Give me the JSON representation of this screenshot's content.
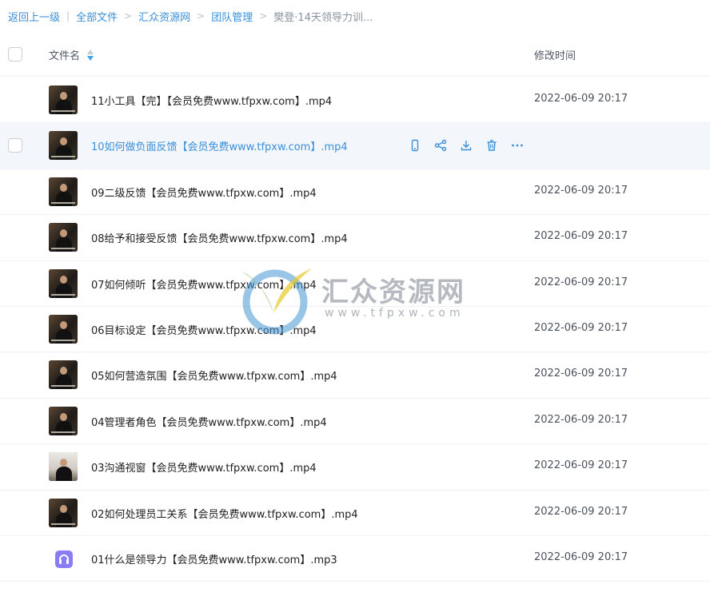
{
  "breadcrumb": {
    "back": "返回上一级",
    "all_files": "全部文件",
    "level1": "汇众资源网",
    "level2": "团队管理",
    "current": "樊登·14天领导力训..."
  },
  "header": {
    "name_col": "文件名",
    "time_col": "修改时间"
  },
  "rows": [
    {
      "name": "11小工具【完】【会员免费www.tfpxw.com】.mp4",
      "time": "2022-06-09 20:17"
    },
    {
      "name": "10如何做负面反馈【会员免费www.tfpxw.com】.mp4",
      "time": ""
    },
    {
      "name": "09二级反馈【会员免费www.tfpxw.com】.mp4",
      "time": "2022-06-09 20:17"
    },
    {
      "name": "08给予和接受反馈【会员免费www.tfpxw.com】.mp4",
      "time": "2022-06-09 20:17"
    },
    {
      "name": "07如何倾听【会员免费www.tfpxw.com】.mp4",
      "time": "2022-06-09 20:17"
    },
    {
      "name": "06目标设定【会员免费www.tfpxw.com】.mp4",
      "time": "2022-06-09 20:17"
    },
    {
      "name": "05如何营造氛围【会员免费www.tfpxw.com】.mp4",
      "time": "2022-06-09 20:17"
    },
    {
      "name": "04管理者角色【会员免费www.tfpxw.com】.mp4",
      "time": "2022-06-09 20:17"
    },
    {
      "name": "03沟通视窗【会员免费www.tfpxw.com】.mp4",
      "time": "2022-06-09 20:17"
    },
    {
      "name": "02如何处理员工关系【会员免费www.tfpxw.com】.mp4",
      "time": "2022-06-09 20:17"
    },
    {
      "name": "01什么是领导力【会员免费www.tfpxw.com】.mp3",
      "time": "2022-06-09 20:17"
    }
  ],
  "row_icons": [
    "phone-icon",
    "share-icon",
    "download-icon",
    "delete-icon",
    "more-icon"
  ],
  "watermark": {
    "title": "汇众资源网",
    "url": "www.tfpxw.com"
  },
  "colors": {
    "accent": "#3a8fd9",
    "hover_row": "#f3f6fb",
    "audio_icon": "#8b7cf6"
  }
}
